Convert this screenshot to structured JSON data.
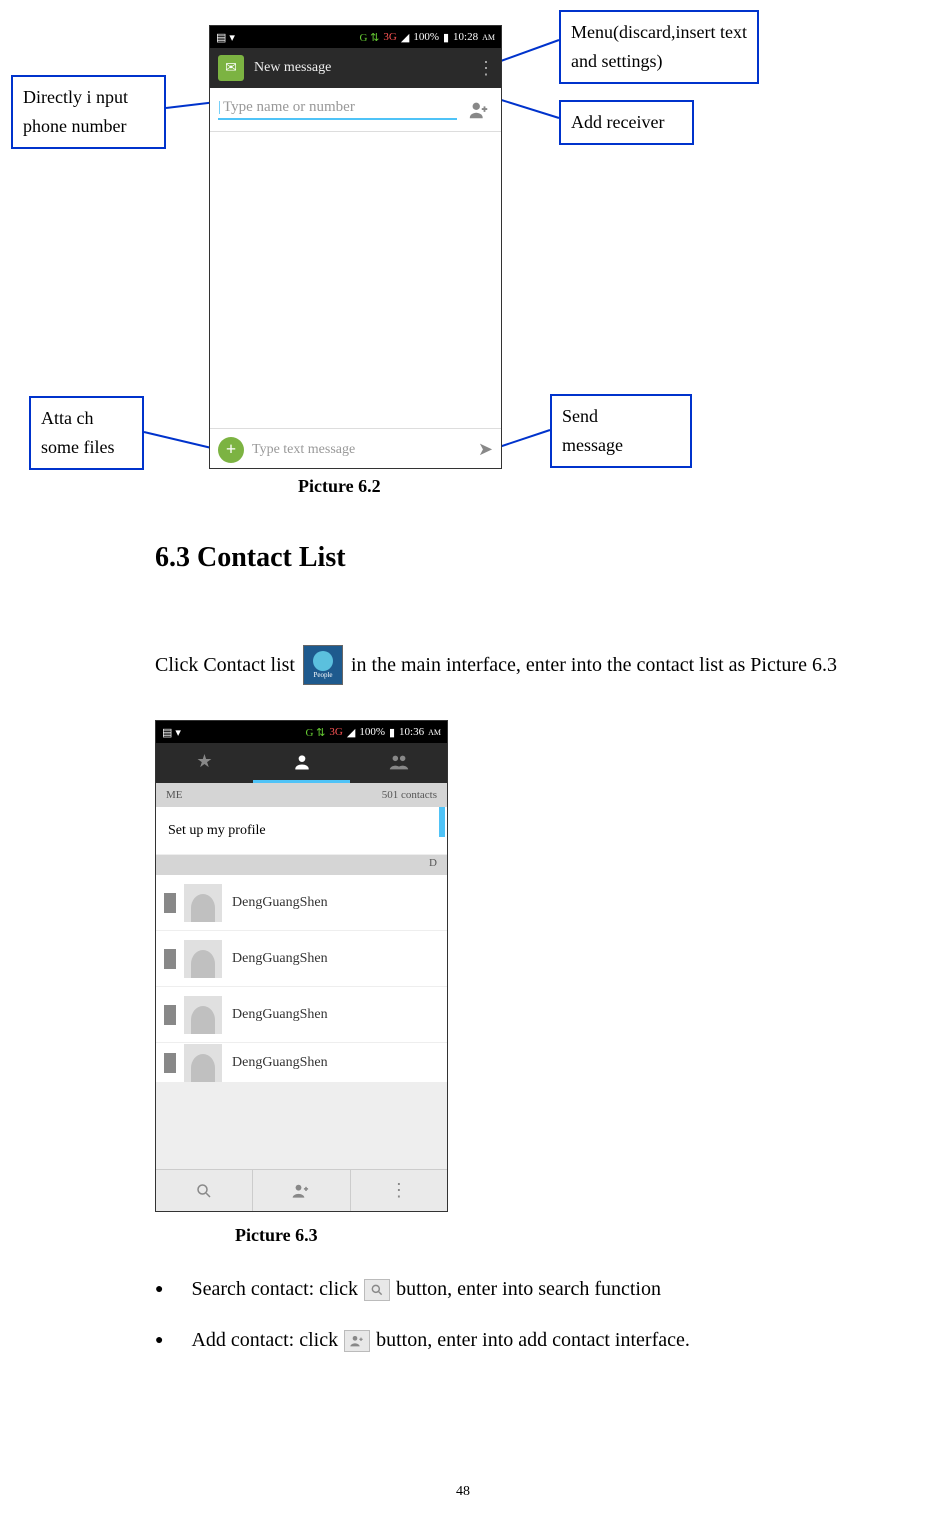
{
  "callouts": {
    "menu": "Menu(discard,insert text and settings)",
    "add_receiver": "Add receiver",
    "direct_input_l1": "Directly i   nput",
    "direct_input_l2": "phone number",
    "attach_l1": "Atta ch",
    "attach_l2": "some files",
    "send_l1": "Send",
    "send_l2": "message"
  },
  "screenshot1": {
    "status_time": "10:28",
    "status_battery": "100%",
    "status_net": "3G",
    "status_am": "AM",
    "header_title": "New message",
    "recipient_placeholder": "Type name or number",
    "compose_placeholder": "Type text message"
  },
  "caption1": "Picture 6.2",
  "heading": "6.3 Contact List",
  "intro_before": "Click Contact list",
  "intro_after": "in the main interface, enter into the contact list as Picture 6.3",
  "people_label": "People",
  "screenshot2": {
    "status_time": "10:36",
    "status_battery": "100%",
    "status_net": "3G",
    "status_am": "AM",
    "me_label": "ME",
    "count": "501 contacts",
    "profile_setup": "Set up my profile",
    "section_letter": "D",
    "contacts": [
      "DengGuangShen",
      "DengGuangShen",
      "DengGuangShen",
      "DengGuangShen"
    ]
  },
  "caption2": "Picture 6.3",
  "bullets": {
    "search_before": "Search contact: click",
    "search_after": "button, enter into search function",
    "add_before": "Add contact: click",
    "add_after": "button, enter into add contact interface."
  },
  "page_number": "48"
}
